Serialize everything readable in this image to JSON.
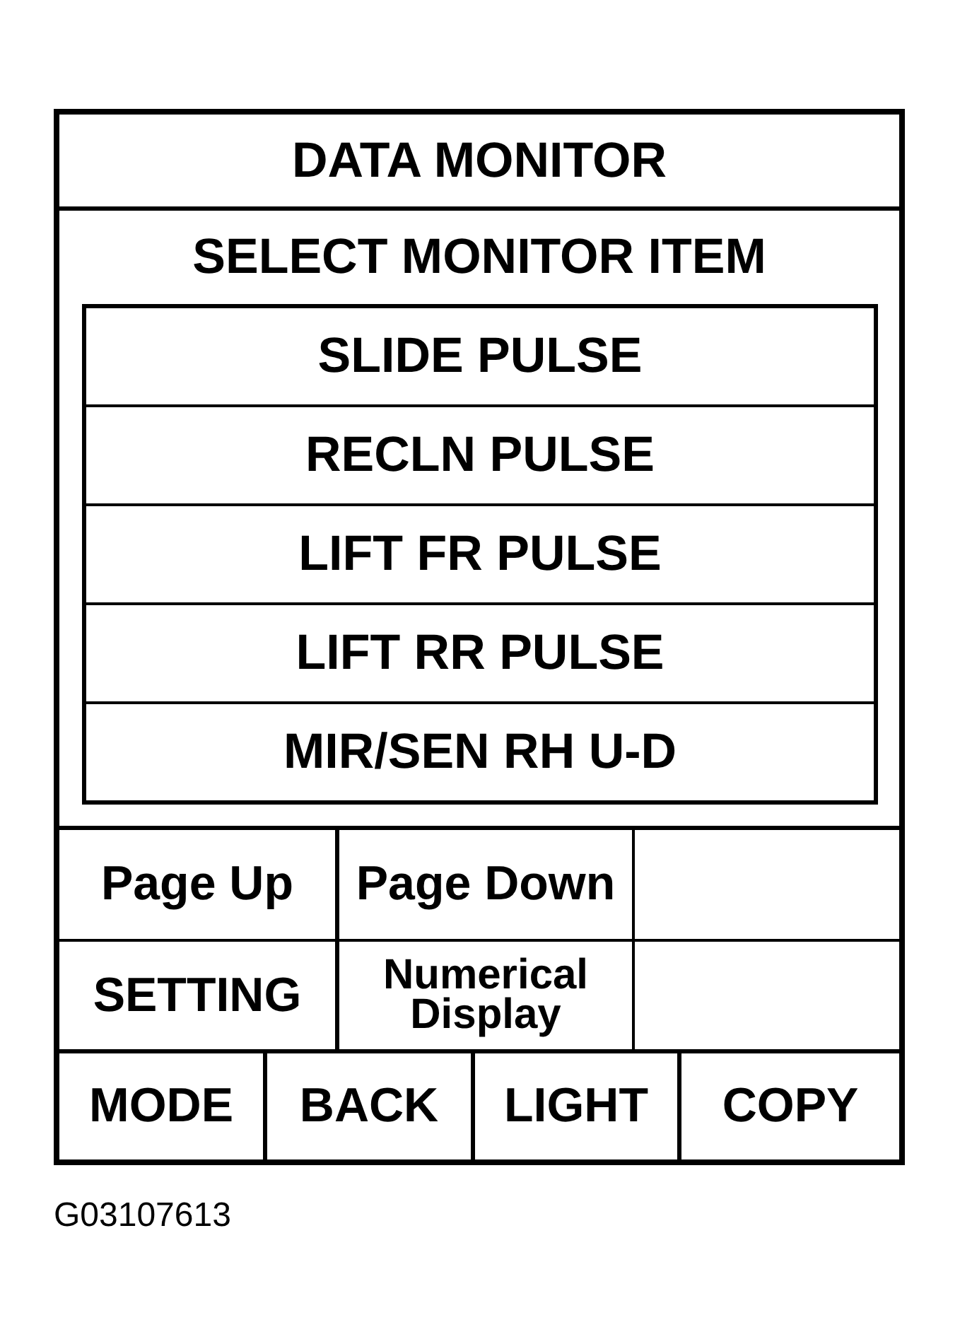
{
  "window": {
    "title": "DATA MONITOR"
  },
  "prompt": "SELECT MONITOR ITEM",
  "monitor_items": [
    {
      "label": "SLIDE PULSE"
    },
    {
      "label": "RECLN PULSE"
    },
    {
      "label": "LIFT FR PULSE"
    },
    {
      "label": "LIFT RR PULSE"
    },
    {
      "label": "MIR/SEN RH U-D"
    }
  ],
  "soft_key_rows": [
    {
      "keys": [
        {
          "label": "Page Up",
          "kind": "large"
        },
        {
          "label": "Page Down",
          "kind": "large"
        }
      ]
    },
    {
      "keys": [
        {
          "label": "SETTING",
          "kind": "large"
        },
        {
          "label": "Numerical Display",
          "kind": "small"
        }
      ]
    }
  ],
  "bottom_buttons": [
    "MODE",
    "BACK",
    "LIGHT",
    "COPY"
  ],
  "figure_id": "G03107613"
}
